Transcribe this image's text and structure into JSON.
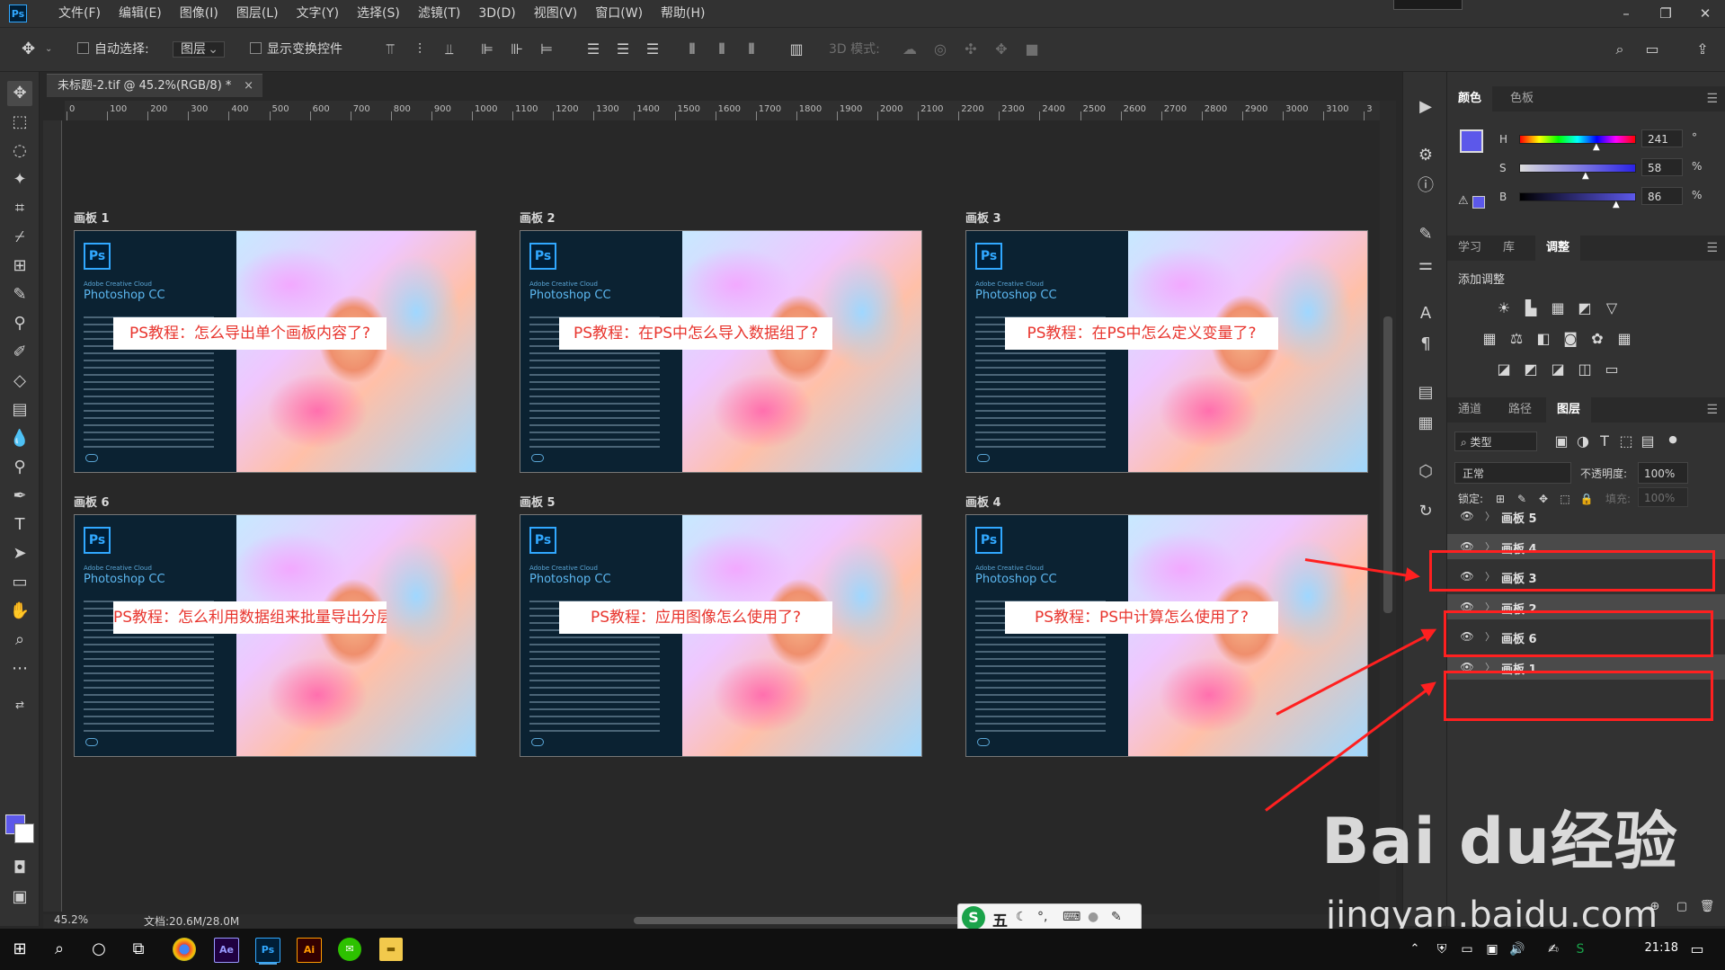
{
  "app": {
    "logo": "Ps",
    "menu": [
      "文件(F)",
      "编辑(E)",
      "图像(I)",
      "图层(L)",
      "文字(Y)",
      "选择(S)",
      "滤镜(T)",
      "3D(D)",
      "视图(V)",
      "窗口(W)",
      "帮助(H)"
    ],
    "window_controls": [
      "–",
      "❐",
      "✕"
    ]
  },
  "options_bar": {
    "auto_select_label": "自动选择:",
    "auto_select_target": "图层",
    "show_transform_label": "显示变换控件",
    "mode_3d_label": "3D 模式:"
  },
  "document": {
    "tab_title": "未标题-2.tif @ 45.2%(RGB/8) *",
    "close_glyph": "×",
    "ruler_ticks": [
      "0",
      "100",
      "200",
      "300",
      "400",
      "500",
      "600",
      "700",
      "800",
      "900",
      "1000",
      "1100",
      "1200",
      "1300",
      "1400",
      "1500",
      "1600",
      "1700",
      "1800",
      "1900",
      "2000",
      "2100",
      "2200",
      "2300",
      "2400",
      "2500",
      "2600",
      "2700",
      "2800",
      "2900",
      "3000",
      "3100",
      "3"
    ],
    "zoom": "45.2%",
    "doc_size": "文档:20.6M/28.0M"
  },
  "artboards": [
    {
      "label": "画板 1",
      "banner": "PS教程：怎么导出单个画板内容了?"
    },
    {
      "label": "画板 2",
      "banner": "PS教程：在PS中怎么导入数据组了?"
    },
    {
      "label": "画板 3",
      "banner": "PS教程：在PS中怎么定义变量了?"
    },
    {
      "label": "画板 6",
      "banner": "PS教程：怎么利用数据组来批量导出分层文件了?"
    },
    {
      "label": "画板 5",
      "banner": "PS教程：应用图像怎么使用了?"
    },
    {
      "label": "画板 4",
      "banner": "PS教程：PS中计算怎么使用了?"
    }
  ],
  "splash": {
    "logo": "Ps",
    "brand": "Adobe Creative Cloud",
    "product": "Photoshop CC"
  },
  "color_panel": {
    "tabs": [
      "颜色",
      "色板"
    ],
    "h_label": "H",
    "h_value": "241",
    "h_unit": "°",
    "s_label": "S",
    "s_value": "58",
    "s_unit": "%",
    "b_label": "B",
    "b_value": "86",
    "b_unit": "%",
    "foreground": "#5c58ea"
  },
  "adjust_panel": {
    "tabs": [
      "学习",
      "库",
      "调整"
    ],
    "title": "添加调整"
  },
  "layers_panel": {
    "tabs": [
      "通道",
      "路径",
      "图层"
    ],
    "filter_label": "类型",
    "blend_mode": "正常",
    "opacity_label": "不透明度:",
    "opacity_value": "100%",
    "lock_label": "锁定:",
    "fill_label": "填充:",
    "fill_value": "100%",
    "layers": [
      {
        "name": "画板 5",
        "highlight": false
      },
      {
        "name": "画板 4",
        "highlight": true
      },
      {
        "name": "画板 3",
        "highlight": false
      },
      {
        "name": "画板 2",
        "highlight": true
      },
      {
        "name": "画板 6",
        "highlight": false
      },
      {
        "name": "画板 1",
        "highlight": true
      }
    ]
  },
  "ime": {
    "logo": "S",
    "mode": "五"
  },
  "taskbar": {
    "time": "21:18"
  },
  "watermark": {
    "logo": "Bai du经验",
    "url": "jingyan.baidu.com"
  },
  "colors": {
    "annotation": "#ff2020",
    "accent": "#31a8ff",
    "banner_text": "#e8352e"
  }
}
